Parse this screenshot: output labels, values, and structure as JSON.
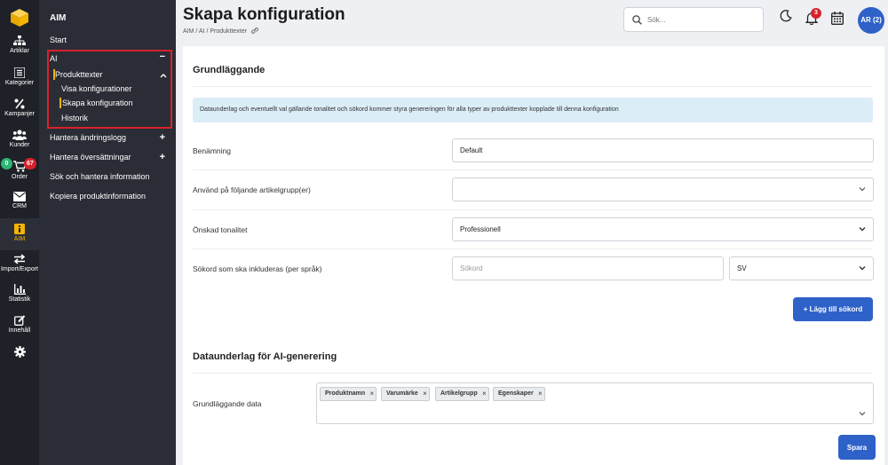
{
  "rail": {
    "items": [
      {
        "label": "Artiklar",
        "icon": "sitemap-icon"
      },
      {
        "label": "Kategorier",
        "icon": "list-icon"
      },
      {
        "label": "Kampanjer",
        "icon": "percent-icon"
      },
      {
        "label": "Kunder",
        "icon": "users-icon"
      },
      {
        "label": "Order",
        "icon": "cart-icon",
        "badge_left": "0",
        "badge_right": "67"
      },
      {
        "label": "CRM",
        "icon": "mail-icon"
      },
      {
        "label": "AIM",
        "icon": "info-icon"
      },
      {
        "label": "Import/Export",
        "icon": "swap-icon"
      },
      {
        "label": "Statistik",
        "icon": "chart-icon"
      },
      {
        "label": "Innehåll",
        "icon": "edit-icon"
      },
      {
        "label": "",
        "icon": "gear-icon"
      }
    ]
  },
  "subnav": {
    "title": "AIM",
    "start": "Start",
    "ai": "AI",
    "ai_toggle": "−",
    "produkttexter": "Produkttexter",
    "visa": "Visa konfigurationer",
    "skapa": "Skapa konfiguration",
    "historik": "Historik",
    "andringslogg": "Hantera ändringslogg",
    "oversattningar": "Hantera översättningar",
    "sok_hantera": "Sök och hantera information",
    "kopiera": "Kopiera produktinformation",
    "plus": "+"
  },
  "header": {
    "title": "Skapa konfiguration",
    "breadcrumb": "AIM / AI / Produkttexter",
    "search_placeholder": "Sök...",
    "notifications": "3",
    "avatar": "AR (2)"
  },
  "form": {
    "section1": "Grundläggande",
    "info": "Dataunderlag och eventuellt val gällande tonalitet och sökord kommer styra genereringen för alla typer av produkttexter kopplade till denna konfiguration",
    "benamning_label": "Benämning",
    "benamning_value": "Default",
    "artikelgrupp_label": "Använd på följande artikelgrupp(er)",
    "artikelgrupp_value": "",
    "tonalitet_label": "Önskad tonalitet",
    "tonalitet_value": "Professionell",
    "sokord_label": "Sökord som ska inkluderas (per språk)",
    "sokord_placeholder": "Sökord",
    "language_value": "SV",
    "add_keyword": "+ Lägg till sökord",
    "section2": "Dataunderlag för AI-generering",
    "grunddata_label": "Grundläggande data",
    "tags": [
      "Produktnamn",
      "Varumärke",
      "Artikelgrupp",
      "Egenskaper"
    ],
    "save": "Spara"
  },
  "colors": {
    "accent": "#f4b400",
    "primary": "#2f62c8",
    "danger": "#d9212c",
    "sidebar": "#2a2d36",
    "rail": "#1f2128"
  }
}
